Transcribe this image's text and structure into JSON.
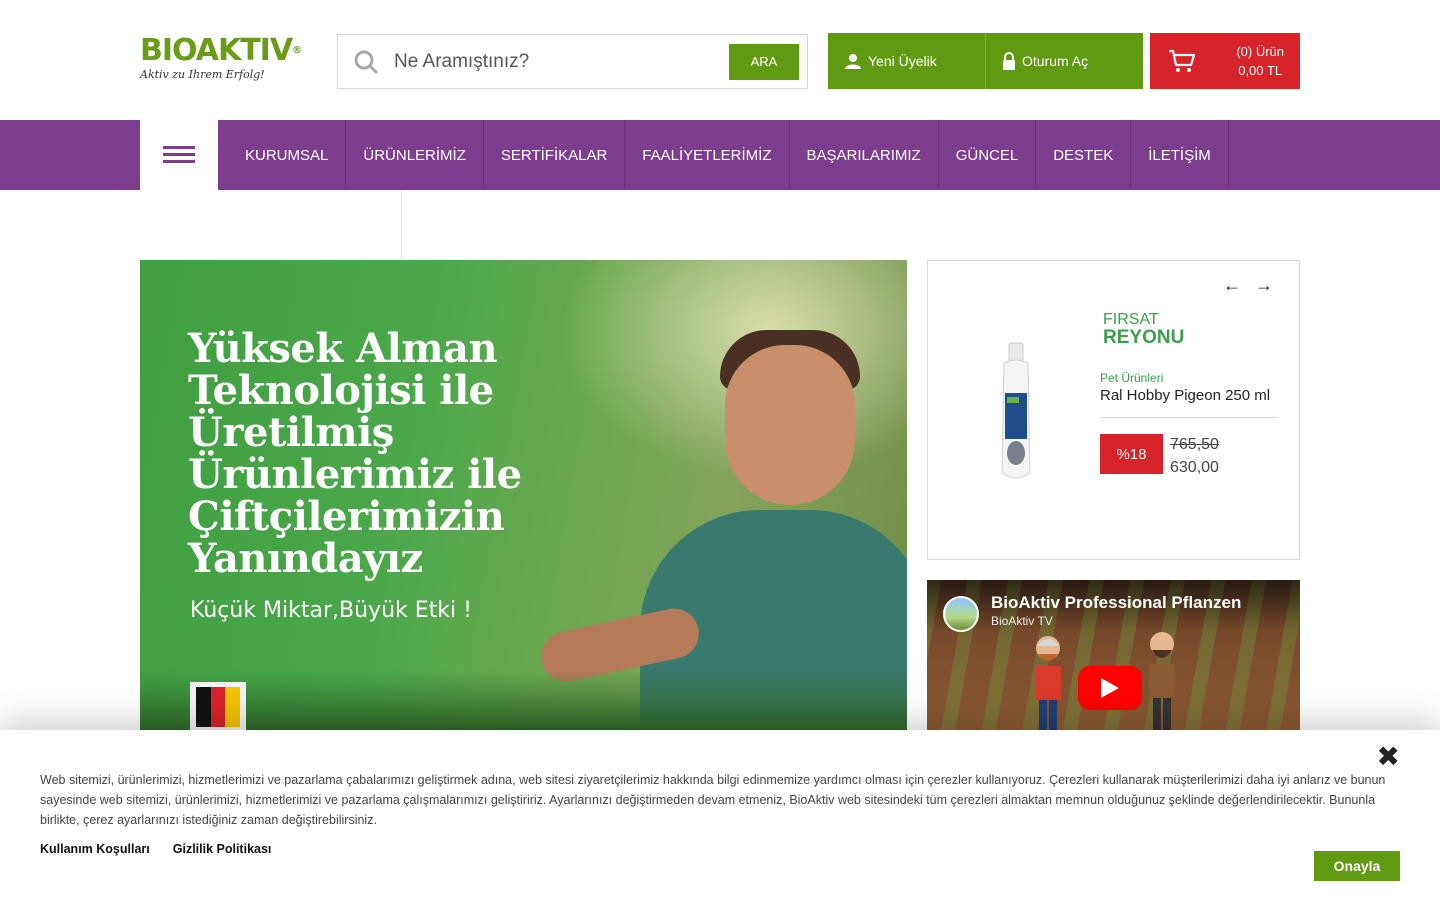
{
  "header": {
    "logo_text": "BIOAKTIV",
    "logo_registered": "®",
    "logo_tagline": "Aktiv zu Ihrem Erfolg!",
    "search_placeholder": "Ne Aramıştınız?",
    "search_button": "ARA",
    "new_member": "Yeni Üyelik",
    "login": "Oturum Aç",
    "cart_count": "(0) Ürün",
    "cart_total": "0,00 TL"
  },
  "nav": {
    "items": [
      "KURUMSAL",
      "ÜRÜNLERİMİZ",
      "SERTİFİKALAR",
      "FAALİYETLERİMİZ",
      "BAŞARILARIMIZ",
      "GÜNCEL",
      "DESTEK",
      "İLETİŞİM"
    ]
  },
  "hero": {
    "headline": [
      "Yüksek Alman",
      "Teknolojisi ile",
      "Üretilmiş",
      "Ürünlerimiz ile",
      "Çiftçilerimizin",
      "Yanındayız"
    ],
    "subline": "Küçük Miktar,Büyük Etki !"
  },
  "deal": {
    "title_1": "FIRSAT",
    "title_2": "REYONU",
    "category": "Pet Ürünleri",
    "product_name": "Ral Hobby Pigeon 250 ml",
    "discount": "%18",
    "old_price": "765,50",
    "new_price": "630,00",
    "prev_icon": "arrow-left-icon",
    "next_icon": "arrow-right-icon"
  },
  "video": {
    "title": "BioAktiv Professional Pflanzen",
    "channel": "BioAktiv TV"
  },
  "cookie": {
    "message": "Web sitemizi, ürünlerimizi, hizmetlerimizi ve pazarlama çabalarımızı geliştirmek adına, web sitesi ziyaretçilerimiz hakkında bilgi edinmemize yardımcı olması için çerezler kullanıyoruz. Çerezleri kullanarak müşterilerimizi daha iyi anlarız ve bunun sayesinde web sitemizi, ürünlerimizi, hizmetlerimizi ve pazarlama çalışmalarımızı geliştiririz. Ayarlarınızı değiştirmeden devam etmeniz, BioAktiv web sitesindeki tüm çerezleri almaktan memnun olduğunuz şeklinde değerlendirilecektir. Bununla birlikte, çerez ayarlarınızı istediğiniz zaman değiştirebilirsiniz.",
    "terms_link": "Kullanım Koşulları",
    "privacy_link": "Gizlilik Politikası",
    "accept_button": "Onayla",
    "close_icon": "close-icon"
  },
  "colors": {
    "green": "#5f9a10",
    "purple": "#7c3d8e",
    "red": "#d7232a",
    "deal_green": "#3a9e4a"
  }
}
